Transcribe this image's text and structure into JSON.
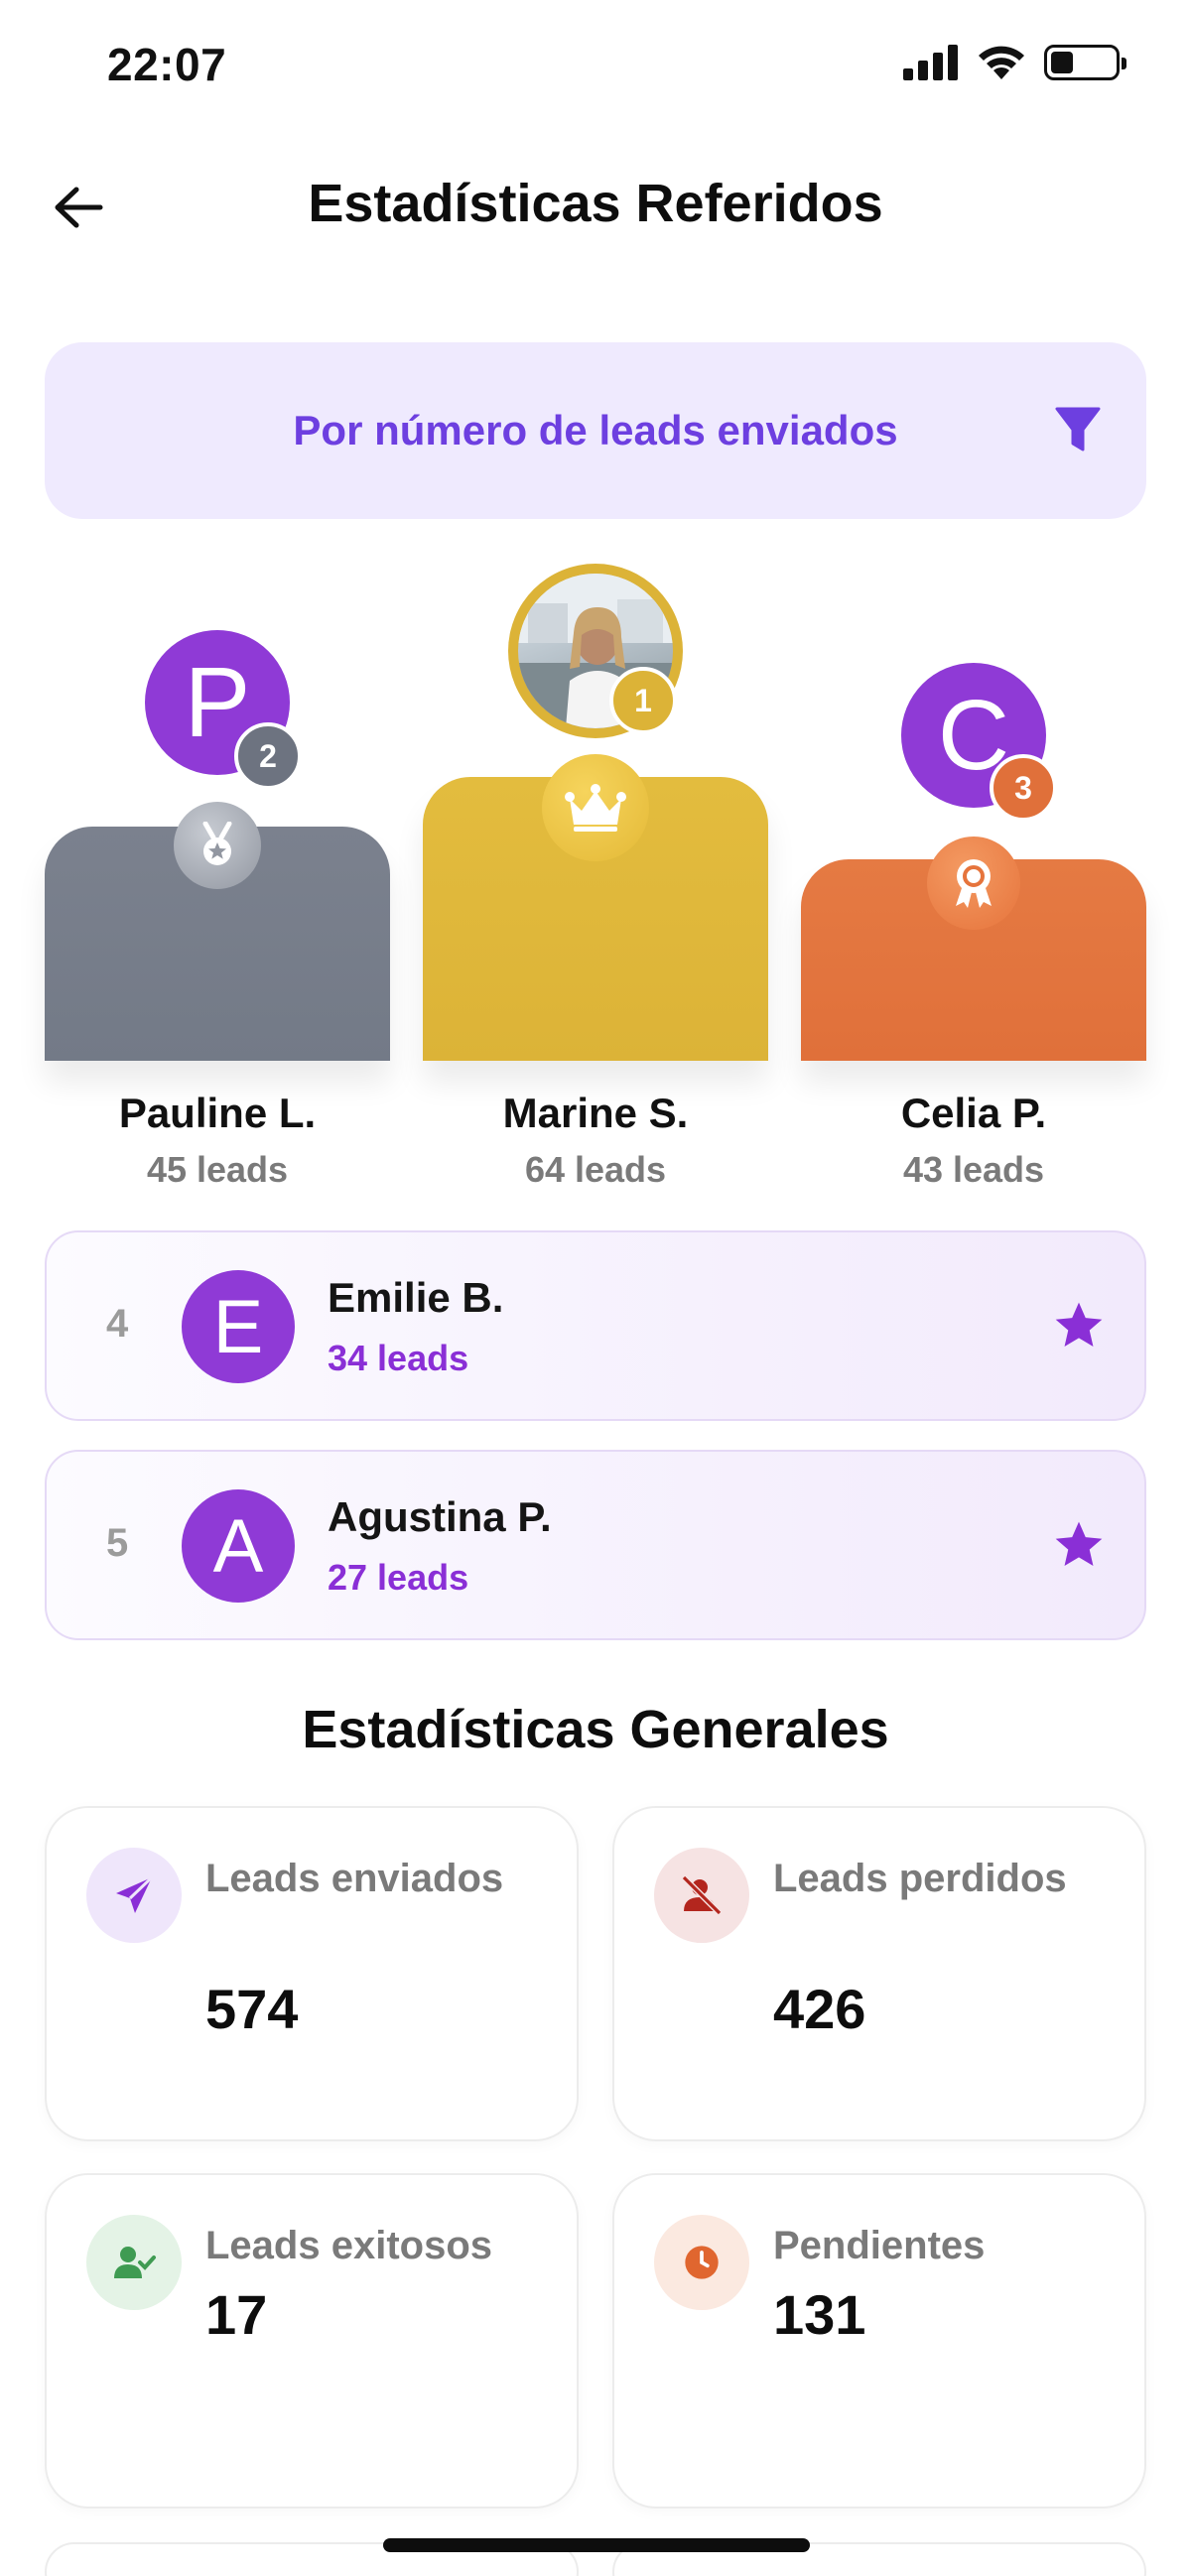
{
  "status_bar": {
    "time": "22:07"
  },
  "header": {
    "title": "Estadísticas Referidos"
  },
  "filter": {
    "label": "Por número de leads enviados"
  },
  "podium": {
    "first": {
      "rank": "1",
      "name": "Marine S.",
      "leads": "64 leads"
    },
    "second": {
      "rank": "2",
      "initial": "P",
      "name": "Pauline L.",
      "leads": "45 leads"
    },
    "third": {
      "rank": "3",
      "initial": "C",
      "name": "Celia P.",
      "leads": "43 leads"
    }
  },
  "ranking": [
    {
      "rank": "4",
      "initial": "E",
      "name": "Emilie B.",
      "leads": "34 leads"
    },
    {
      "rank": "5",
      "initial": "A",
      "name": "Agustina P.",
      "leads": "27 leads"
    }
  ],
  "general_stats": {
    "title": "Estadísticas Generales",
    "sent": {
      "label": "Leads enviados",
      "value": "574"
    },
    "lost": {
      "label": "Leads perdidos",
      "value": "426"
    },
    "success": {
      "label": "Leads exitosos",
      "value": "17"
    },
    "pending": {
      "label": "Pendientes",
      "value": "131"
    }
  },
  "colors": {
    "accent_purple": "#6d3fe0",
    "avatar_purple": "#8f3ad6",
    "gold": "#dcb337",
    "silver": "#737a87",
    "bronze": "#e0703a"
  }
}
